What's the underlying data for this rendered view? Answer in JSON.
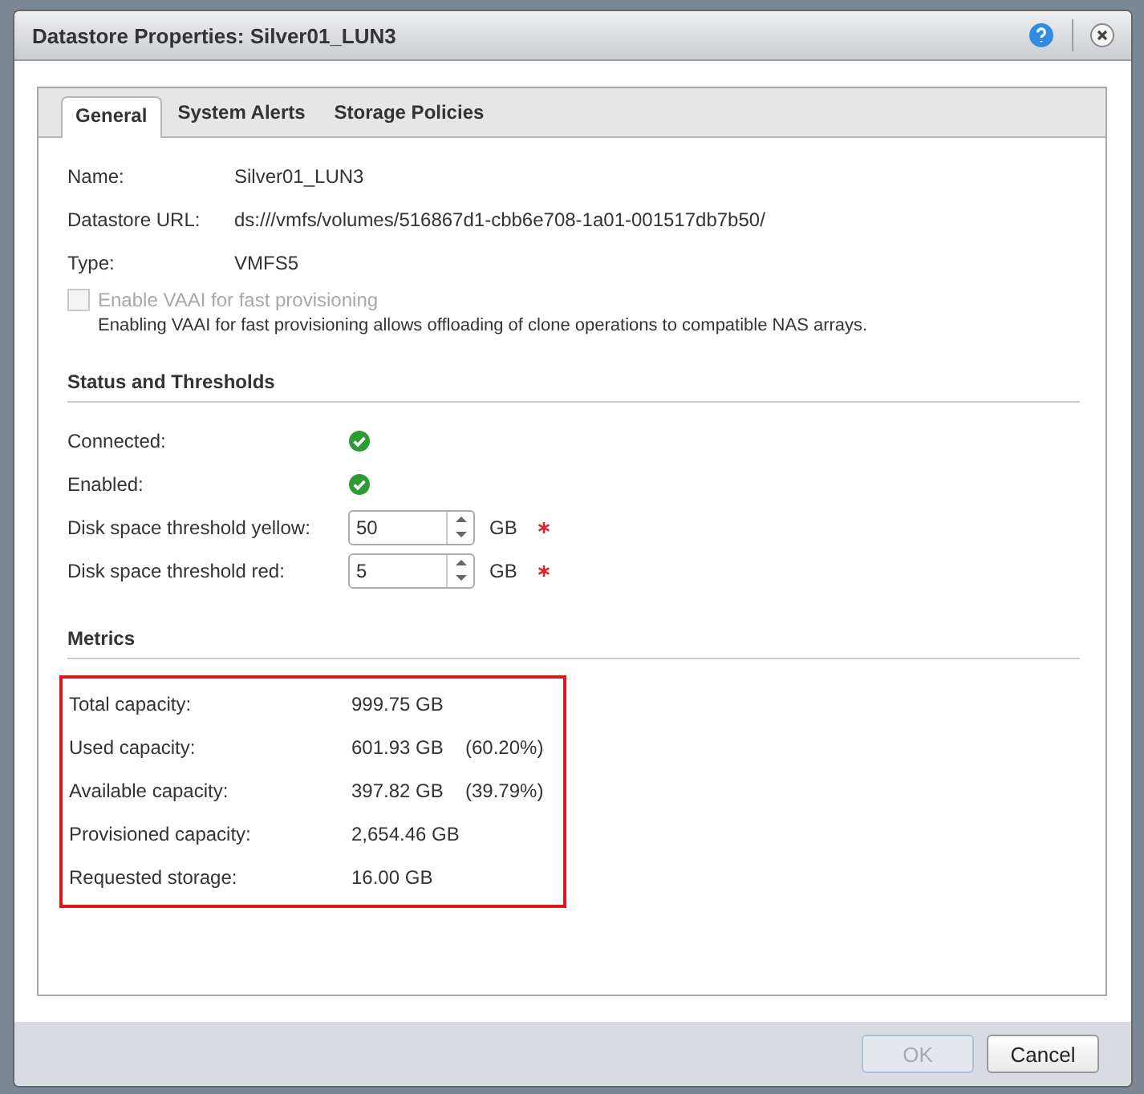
{
  "window": {
    "title": "Datastore Properties: Silver01_LUN3"
  },
  "tabs": [
    {
      "label": "General",
      "selected": true
    },
    {
      "label": "System Alerts",
      "selected": false
    },
    {
      "label": "Storage Policies",
      "selected": false
    }
  ],
  "properties": [
    {
      "label": "Name:",
      "value": "Silver01_LUN3"
    },
    {
      "label": "Datastore URL:",
      "value": "ds:///vmfs/volumes/516867d1-cbb6e708-1a01-001517db7b50/"
    },
    {
      "label": "Type:",
      "value": "VMFS5"
    }
  ],
  "vaai": {
    "label": "Enable VAAI for fast provisioning",
    "checked": false,
    "disabled": true,
    "description": "Enabling VAAI for fast provisioning allows offloading of clone operations to compatible NAS arrays."
  },
  "status": {
    "heading": "Status and Thresholds",
    "rows": [
      {
        "kind": "indicator",
        "label": "Connected:",
        "on": true
      },
      {
        "kind": "indicator",
        "label": "Enabled:",
        "on": true
      },
      {
        "kind": "spinner",
        "label": "Disk space threshold yellow:",
        "value": "50",
        "unit": "GB",
        "required": true
      },
      {
        "kind": "spinner",
        "label": "Disk space threshold red:",
        "value": "5",
        "unit": "GB",
        "required": true
      }
    ]
  },
  "metrics": {
    "heading": "Metrics",
    "highlighted": true,
    "rows": [
      {
        "label": "Total capacity:",
        "value": "999.75 GB"
      },
      {
        "label": "Used capacity:",
        "value": "601.93 GB",
        "percent": "(60.20%)"
      },
      {
        "label": "Available capacity:",
        "value": "397.82 GB",
        "percent": "(39.79%)"
      },
      {
        "label": "Provisioned capacity:",
        "value": "2,654.46 GB"
      },
      {
        "label": "Requested storage:",
        "value": "16.00 GB"
      }
    ]
  },
  "buttons": [
    {
      "label": "OK",
      "disabled": true
    },
    {
      "label": "Cancel",
      "disabled": false
    }
  ]
}
